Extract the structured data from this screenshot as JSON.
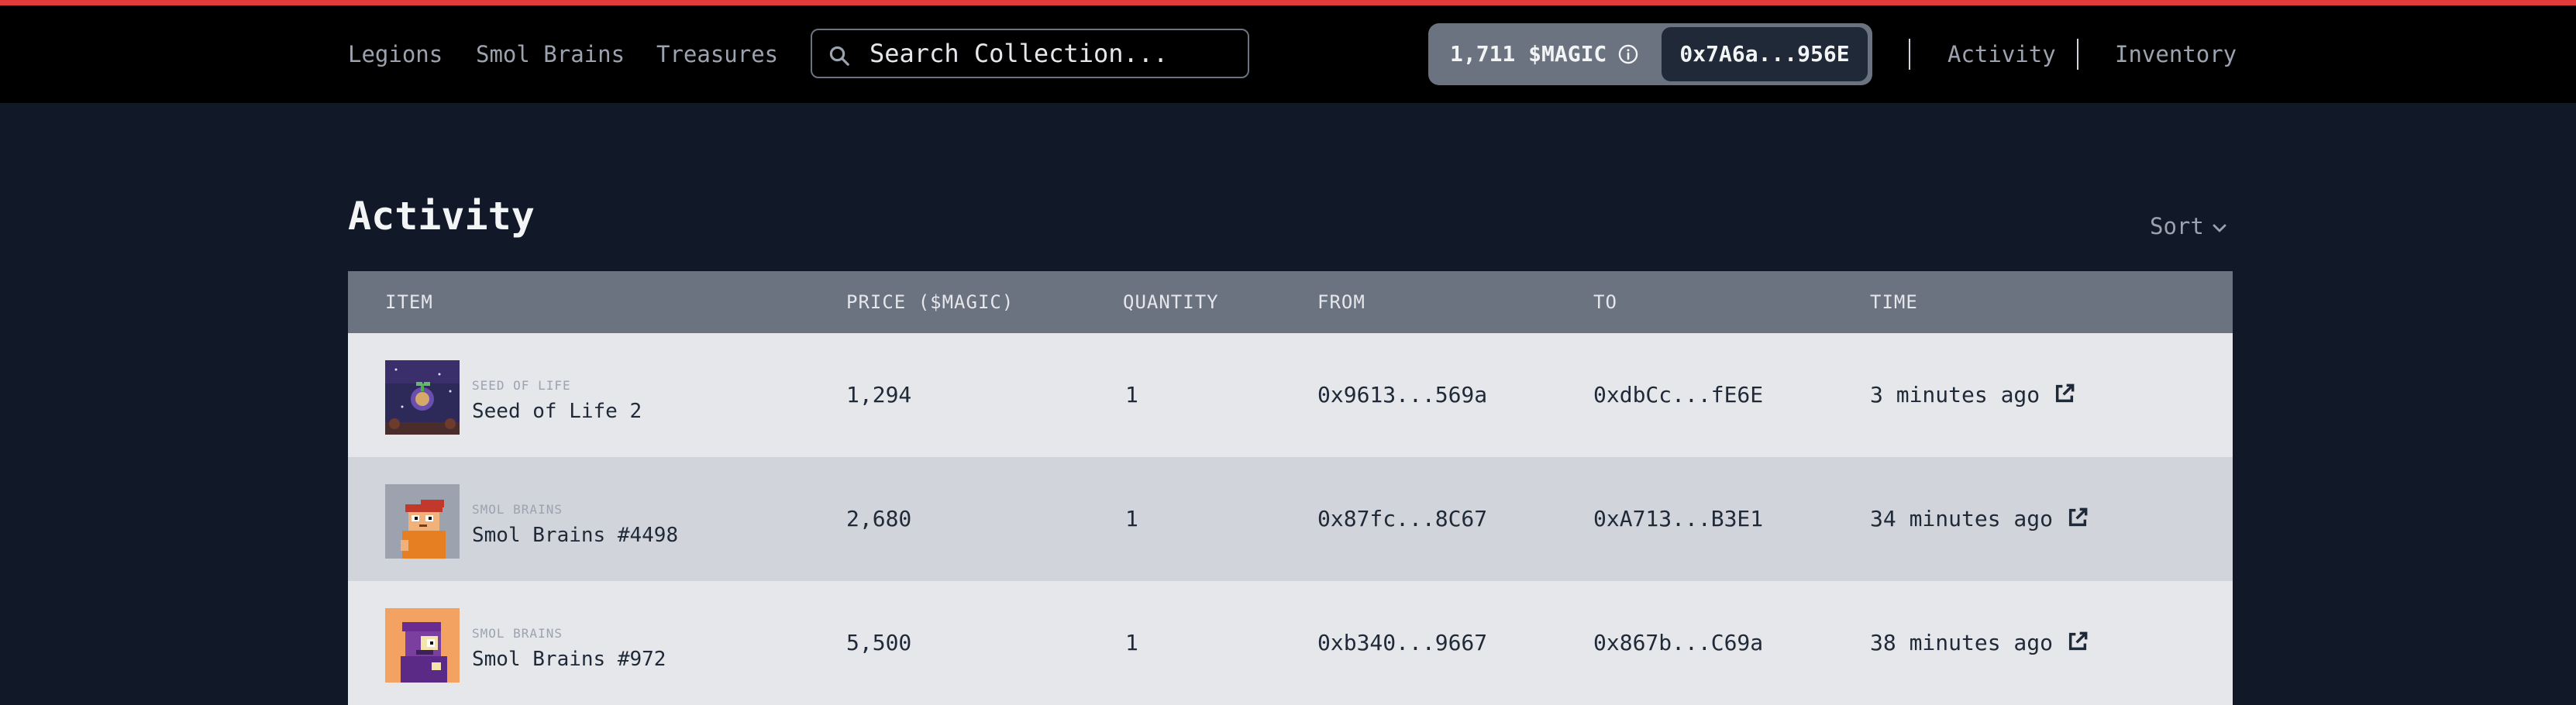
{
  "nav": {
    "links": [
      "Legions",
      "Smol Brains",
      "Treasures"
    ],
    "search_placeholder": "Search Collection...",
    "balance": "1,711 $MAGIC",
    "address": "0x7A6a...956E",
    "right_links": [
      "Activity",
      "Inventory"
    ]
  },
  "page": {
    "title": "Activity",
    "sort_label": "Sort"
  },
  "table": {
    "columns": [
      "ITEM",
      "PRICE ($MAGIC)",
      "QUANTITY",
      "FROM",
      "TO",
      "TIME"
    ],
    "rows": [
      {
        "collection": "SEED OF LIFE",
        "name": "Seed of Life 2",
        "price": "1,294",
        "quantity": "1",
        "from": "0x9613...569a",
        "to": "0xdbCc...fE6E",
        "time": "3 minutes ago"
      },
      {
        "collection": "SMOL BRAINS",
        "name": "Smol Brains #4498",
        "price": "2,680",
        "quantity": "1",
        "from": "0x87fc...8C67",
        "to": "0xA713...B3E1",
        "time": "34 minutes ago"
      },
      {
        "collection": "SMOL BRAINS",
        "name": "Smol Brains #972",
        "price": "5,500",
        "quantity": "1",
        "from": "0xb340...9667",
        "to": "0x867b...C69a",
        "time": "38 minutes ago"
      }
    ]
  },
  "colors": {
    "accent": "#e23b3b",
    "background": "#111827",
    "navbar": "#000000",
    "table_header": "#6b7280"
  },
  "icons": {
    "search": "search-icon",
    "info": "info-icon",
    "sort": "chevron-down-icon",
    "external": "external-link-icon"
  }
}
